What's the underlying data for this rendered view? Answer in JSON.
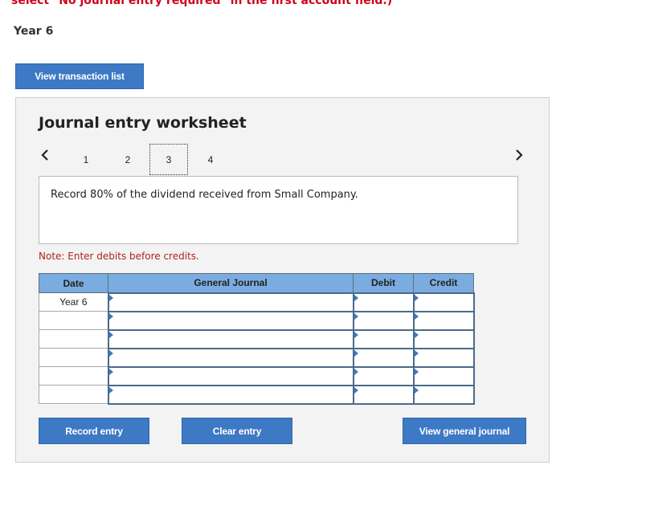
{
  "instruction": "select \"No journal entry required\" in the first account field.)",
  "year_heading": "Year 6",
  "view_transaction_list": "View transaction list",
  "worksheet": {
    "title": "Journal entry worksheet",
    "pages": [
      "1",
      "2",
      "3",
      "4"
    ],
    "active_page": "3",
    "description": "Record 80% of the dividend received from Small Company.",
    "note": "Note: Enter debits before credits.",
    "columns": {
      "date": "Date",
      "general_journal": "General Journal",
      "debit": "Debit",
      "credit": "Credit"
    },
    "rows": [
      {
        "date": "Year 6",
        "account": "",
        "debit": "",
        "credit": ""
      },
      {
        "date": "",
        "account": "",
        "debit": "",
        "credit": ""
      },
      {
        "date": "",
        "account": "",
        "debit": "",
        "credit": ""
      },
      {
        "date": "",
        "account": "",
        "debit": "",
        "credit": ""
      },
      {
        "date": "",
        "account": "",
        "debit": "",
        "credit": ""
      },
      {
        "date": "",
        "account": "",
        "debit": "",
        "credit": ""
      }
    ],
    "record_entry": "Record entry",
    "clear_entry": "Clear entry",
    "view_general_journal": "View general journal"
  },
  "icons": {
    "prev": "chevron-left-icon",
    "next": "chevron-right-icon"
  },
  "colors": {
    "button": "#3d79c4",
    "header": "#7bacdf",
    "instruction": "#d0021b",
    "note": "#b0231c"
  }
}
